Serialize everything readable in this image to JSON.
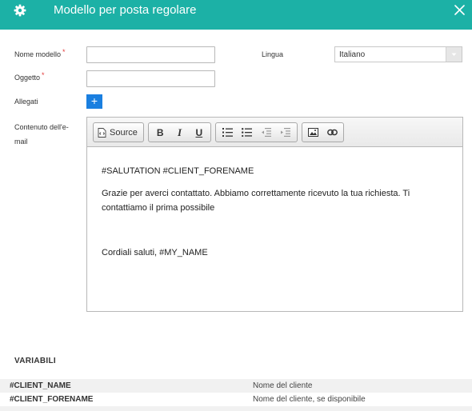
{
  "header": {
    "title": "Modello per posta regolare",
    "icon": "gear-icon",
    "close_icon": "close-icon",
    "color": "#1cb1a6"
  },
  "form": {
    "name_label": "Nome modello",
    "name_value": "",
    "required_mark": "*",
    "language_label": "Lingua",
    "language_value": "Italiano",
    "subject_label": "Oggetto",
    "subject_value": "",
    "attachments_label": "Allegati",
    "add_label": "+",
    "content_label_line1": "Contenuto dell'e-",
    "content_label_line2": "mail"
  },
  "editor": {
    "source_label": "Source",
    "toolbar_icons": [
      "source-icon",
      "bold-icon",
      "italic-icon",
      "underline-icon",
      "numbered-list-icon",
      "bulleted-list-icon",
      "outdent-icon",
      "indent-icon",
      "image-icon",
      "link-icon"
    ],
    "bold_label": "B",
    "italic_label": "I",
    "underline_label": "U",
    "paragraphs": [
      "#SALUTATION #CLIENT_FORENAME",
      "Grazie per averci contattato. Abbiamo correttamente ricevuto la tua richiesta. Ti contattiamo il prima possibile",
      "",
      "Cordiali saluti, #MY_NAME"
    ]
  },
  "variables": {
    "title": "VARIABILI",
    "rows": [
      {
        "name": "#CLIENT_NAME",
        "description": "Nome del cliente"
      },
      {
        "name": "#CLIENT_FORENAME",
        "description": "Nome del cliente, se disponibile"
      }
    ]
  }
}
